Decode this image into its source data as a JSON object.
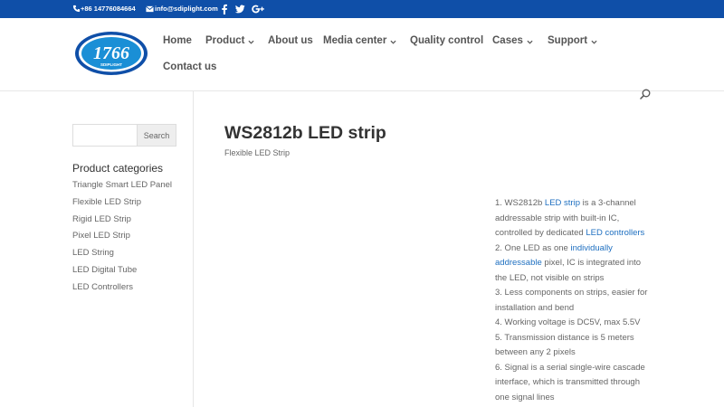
{
  "topbar": {
    "phone": "+86 14776084664",
    "email": "info@sdiplight.com",
    "social_icons": [
      "facebook-icon",
      "twitter-icon",
      "google-plus-icon"
    ],
    "background": "#0f4fa8"
  },
  "logo": {
    "number": "1766",
    "brand": "SDIPLIGHT",
    "colors": {
      "outer": "#0f4fa8",
      "ring": "#ffffff",
      "inner": "#1a8fd6"
    }
  },
  "nav": {
    "items": [
      {
        "label": "Home"
      },
      {
        "label": "Product"
      },
      {
        "label": "About us"
      },
      {
        "label": "Media center"
      },
      {
        "label": "Quality control"
      },
      {
        "label": "Cases"
      },
      {
        "label": "Support"
      },
      {
        "label": "Contact us"
      }
    ]
  },
  "sidebar": {
    "search_placeholder": "",
    "search_button": "Search",
    "categories_title": "Product categories",
    "categories": [
      "Triangle Smart LED Panel",
      "Flexible LED Strip",
      "Rigid LED Strip",
      "Pixel LED Strip",
      "LED String",
      "LED Digital Tube",
      "LED Controllers"
    ]
  },
  "product": {
    "title": "WS2812b LED strip",
    "category": "Flexible LED Strip",
    "link_color": "#1e6fc0",
    "desc": {
      "l1_pre": "1. WS2812b ",
      "l1_link": "LED strip",
      "l1_mid": " is a 3-channel addressable strip with built-in IC, controlled by dedicated ",
      "l1_link2": "LED controllers",
      "l2_pre": "2. One LED as one ",
      "l2_link": "individually addressable",
      "l2_post": " pixel, IC is integrated into the LED, not visible on strips",
      "l3": "3. Less components on strips, easier for installation and bend",
      "l4": "4. Working voltage is DC5V, max 5.5V",
      "l5": "5. Transmission distance is 5 meters between any 2 pixels",
      "l6": "6. Signal is a serial single-wire cascade interface, which is transmitted through one signal lines"
    }
  }
}
